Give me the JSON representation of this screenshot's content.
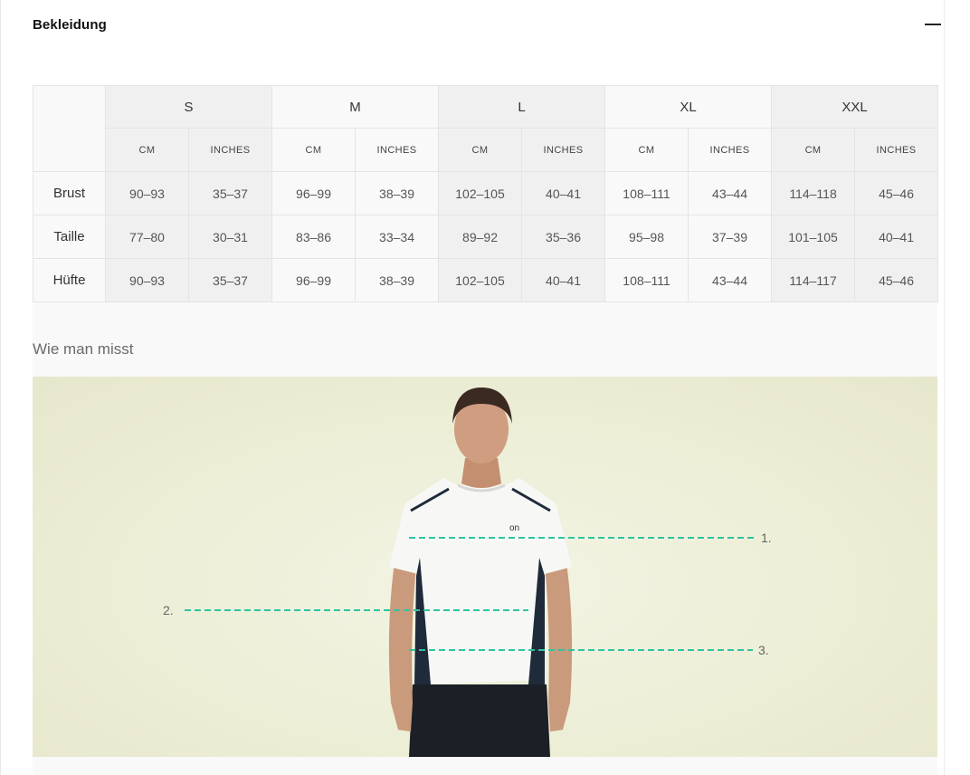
{
  "accordion": {
    "title": "Bekleidung"
  },
  "size_table": {
    "sizes": [
      "S",
      "M",
      "L",
      "XL",
      "XXL"
    ],
    "units": [
      "CM",
      "INCHES"
    ],
    "rows": [
      {
        "label": "Brust",
        "values": [
          "90–93",
          "35–37",
          "96–99",
          "38–39",
          "102–105",
          "40–41",
          "108–111",
          "43–44",
          "114–118",
          "45–46"
        ]
      },
      {
        "label": "Taille",
        "values": [
          "77–80",
          "30–31",
          "83–86",
          "33–34",
          "89–92",
          "35–36",
          "95–98",
          "37–39",
          "101–105",
          "40–41"
        ]
      },
      {
        "label": "Hüfte",
        "values": [
          "90–93",
          "35–37",
          "96–99",
          "38–39",
          "102–105",
          "40–41",
          "108–111",
          "43–44",
          "114–117",
          "45–46"
        ]
      }
    ]
  },
  "how_to_measure": {
    "title": "Wie man misst",
    "markers": [
      "1.",
      "2.",
      "3."
    ],
    "line_color": "#2ec4a0"
  }
}
